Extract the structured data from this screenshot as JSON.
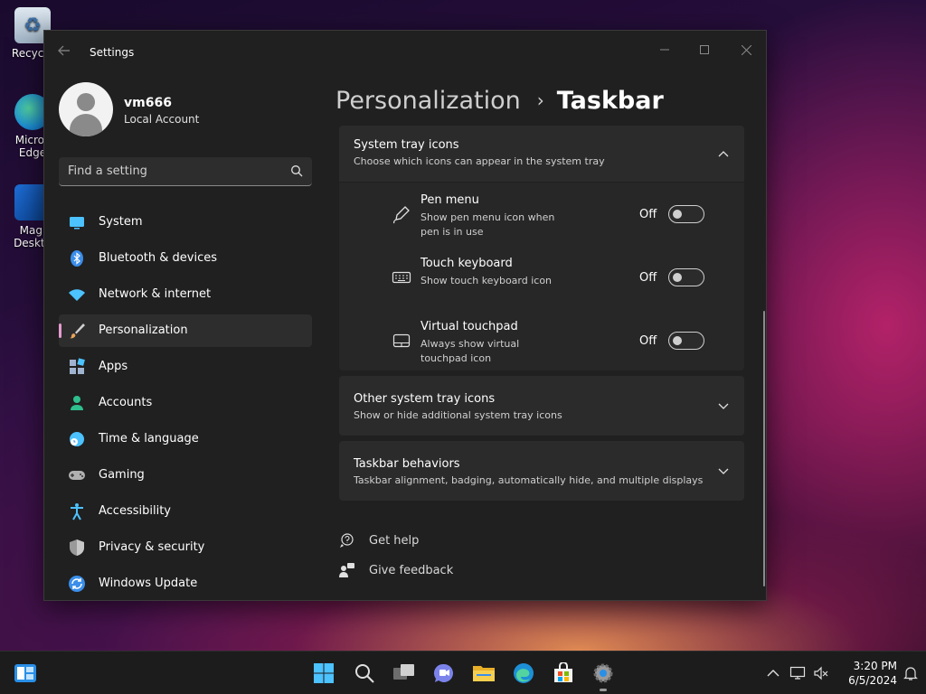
{
  "desktop": {
    "icons": [
      {
        "label": "Recycle"
      },
      {
        "label": "Micros",
        "label2": "Edge"
      },
      {
        "label": "Magi",
        "label2": "Deskto"
      }
    ]
  },
  "window": {
    "title": "Settings"
  },
  "profile": {
    "name": "vm666",
    "type": "Local Account"
  },
  "search": {
    "placeholder": "Find a setting"
  },
  "nav": {
    "items": [
      {
        "label": "System",
        "icon": "monitor-icon",
        "color": "#4cc2ff"
      },
      {
        "label": "Bluetooth & devices",
        "icon": "bluetooth-icon",
        "color": "#3b8eea"
      },
      {
        "label": "Network & internet",
        "icon": "wifi-icon",
        "color": "#4cc2ff"
      },
      {
        "label": "Personalization",
        "icon": "brush-icon",
        "color": "#e8a35a",
        "selected": true
      },
      {
        "label": "Apps",
        "icon": "apps-icon",
        "color": "#a0b4d0"
      },
      {
        "label": "Accounts",
        "icon": "person-icon",
        "color": "#2fbf8f"
      },
      {
        "label": "Time & language",
        "icon": "globe-clock-icon",
        "color": "#4cc2ff"
      },
      {
        "label": "Gaming",
        "icon": "controller-icon",
        "color": "#b0b0b0"
      },
      {
        "label": "Accessibility",
        "icon": "accessibility-icon",
        "color": "#4cc2ff"
      },
      {
        "label": "Privacy & security",
        "icon": "shield-icon",
        "color": "#9a9a9a"
      },
      {
        "label": "Windows Update",
        "icon": "update-icon",
        "color": "#3b8eea"
      }
    ]
  },
  "breadcrumb": {
    "parent": "Personalization",
    "separator": "›",
    "current": "Taskbar"
  },
  "system_tray": {
    "title": "System tray icons",
    "desc": "Choose which icons can appear in the system tray",
    "items": [
      {
        "title": "Pen menu",
        "desc": "Show pen menu icon when pen is in use",
        "state": "Off",
        "icon": "pen-icon"
      },
      {
        "title": "Touch keyboard",
        "desc": "Show touch keyboard icon",
        "state": "Off",
        "icon": "keyboard-icon"
      },
      {
        "title": "Virtual touchpad",
        "desc": "Always show virtual touchpad icon",
        "state": "Off",
        "icon": "touchpad-icon"
      }
    ]
  },
  "other_tray": {
    "title": "Other system tray icons",
    "desc": "Show or hide additional system tray icons"
  },
  "behaviors": {
    "title": "Taskbar behaviors",
    "desc": "Taskbar alignment, badging, automatically hide, and multiple displays"
  },
  "help": {
    "get_help": "Get help",
    "give_feedback": "Give feedback"
  },
  "taskbar": {
    "time": "3:20 PM",
    "date": "6/5/2024"
  }
}
